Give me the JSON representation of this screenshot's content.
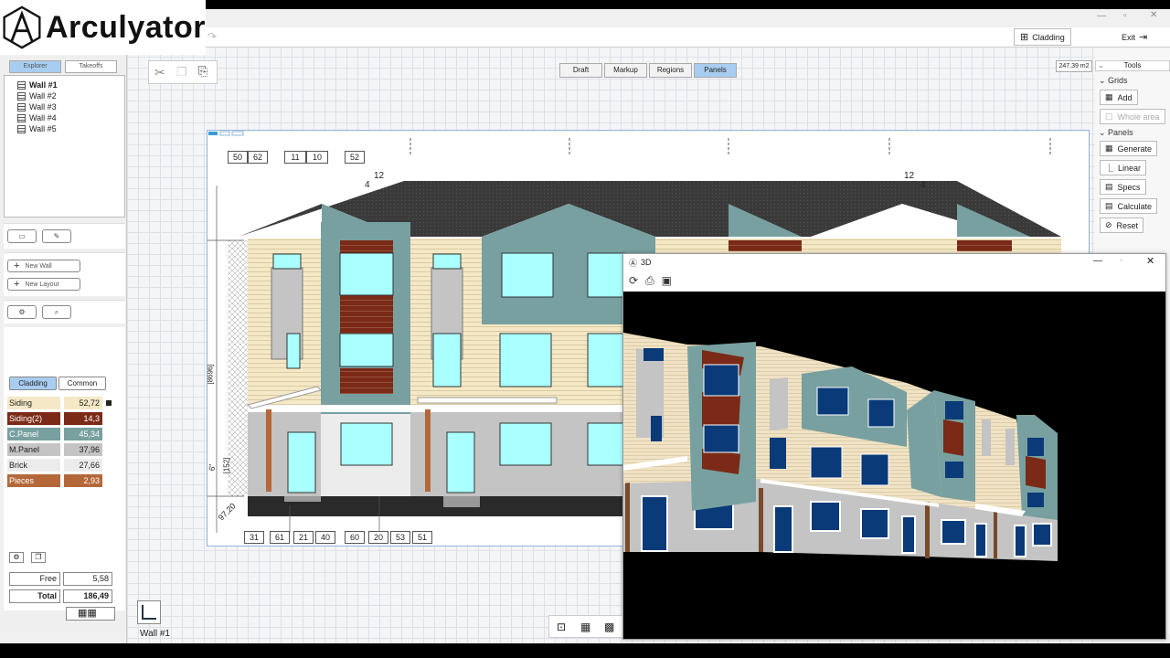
{
  "app": {
    "name": "Arculyator"
  },
  "topbar": {
    "cladding_label": "Cladding",
    "exit_label": "Exit"
  },
  "left": {
    "explorer_tab": "Explorer",
    "takeoffs_tab": "Takeoffs",
    "walls": [
      "Wall #1",
      "Wall #2",
      "Wall #3",
      "Wall #4",
      "Wall #5"
    ],
    "new_wall": "New Wall",
    "new_layout": "New Layout",
    "cladding_tab": "Cladding",
    "common_tab": "Common",
    "materials": [
      {
        "name": "Siding",
        "value": "52,72",
        "color": "#f5e8c6",
        "text": "#222"
      },
      {
        "name": "Siding(2)",
        "value": "14,3",
        "color": "#7a2a16",
        "text": "#fff"
      },
      {
        "name": "C.Panel",
        "value": "45,34",
        "color": "#78a0a0",
        "text": "#fff"
      },
      {
        "name": "M.Panel",
        "value": "37,96",
        "color": "#c4c4c4",
        "text": "#222"
      },
      {
        "name": "Brick",
        "value": "27,66",
        "color": "#ececec",
        "text": "#222"
      },
      {
        "name": "Pieces",
        "value": "2,93",
        "color": "#b4683a",
        "text": "#fff"
      }
    ],
    "free_label": "Free",
    "free_value": "5,58",
    "total_label": "Total",
    "total_value": "186,49"
  },
  "canvas": {
    "area_readout": "247,39 m2",
    "modes": [
      "Draft",
      "Markup",
      "Regions",
      "Panels"
    ],
    "active_mode": "Panels",
    "current_wall": "Wall #1",
    "dims_top": [
      "50",
      "62",
      "11",
      "10",
      "52"
    ],
    "dims_bottom": [
      "31",
      "61",
      "21",
      "40",
      "60",
      "20",
      "53",
      "51"
    ],
    "slope_left": [
      "12",
      "4"
    ],
    "slope_right": [
      "12",
      "4"
    ],
    "height_dim": "[8696]",
    "dim_small": "[152]",
    "dim_six": "6\"",
    "dim_corner": "97,20"
  },
  "tools": {
    "title": "Tools",
    "grids_label": "Grids",
    "add": "Add",
    "whole_area": "Whole area",
    "panels_label": "Panels",
    "generate": "Generate",
    "linear": "Linear",
    "specs": "Specs",
    "calculate": "Calculate",
    "reset": "Reset"
  },
  "window3d": {
    "title": "3D"
  },
  "colors": {
    "siding": "#f5e8c6",
    "siding2": "#7a2a16",
    "cpanel": "#78a0a0",
    "mpanel": "#c4c4c4",
    "window": "#aaffff",
    "roof": "#3a3a3a",
    "accent": "#a8cdf0"
  }
}
